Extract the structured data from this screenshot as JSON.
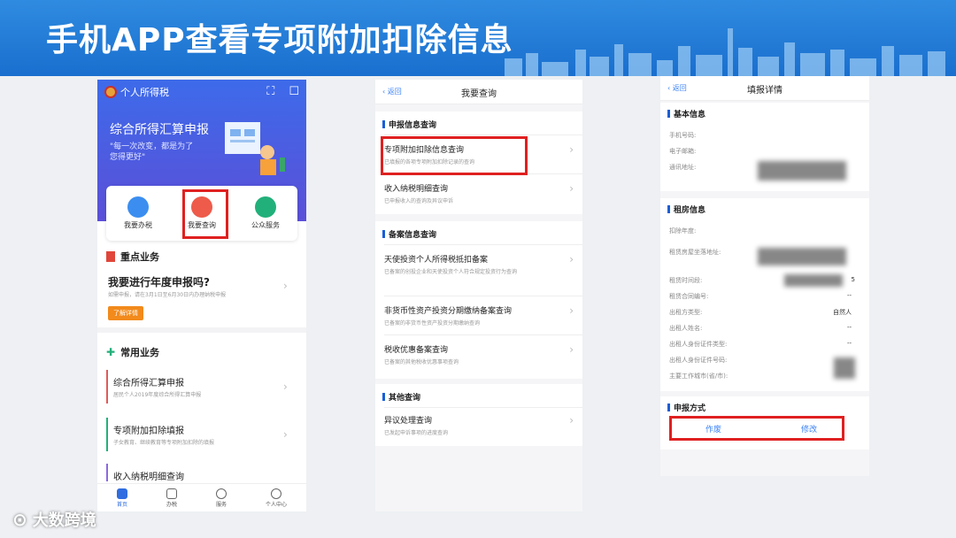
{
  "banner": {
    "title": "手机APP查看专项附加扣除信息"
  },
  "watermark": {
    "text": "大数跨境"
  },
  "phone1": {
    "app_name": "个人所得税",
    "hero_title": "综合所得汇算申报",
    "hero_sub": "\"每一次改变，都是为了您得更好\"",
    "actions": [
      {
        "label": "我要办税"
      },
      {
        "label": "我要查询"
      },
      {
        "label": "公众服务"
      }
    ],
    "section1_title": "重点业务",
    "key_title": "我要进行年度申报吗?",
    "key_sub": "如需申报，请在3月1日至6月30日内办理纳税申报",
    "key_button": "了解详情",
    "section2_title": "常用业务",
    "common": [
      {
        "title": "综合所得汇算申报",
        "sub": "居民个人2019年度综合所得汇算申报"
      },
      {
        "title": "专项附加扣除填报",
        "sub": "子女教育、继续教育等专项附加扣除的填报"
      },
      {
        "title": "收入纳税明细查询",
        "sub": ""
      }
    ],
    "tabs": [
      {
        "label": "首页"
      },
      {
        "label": "办税"
      },
      {
        "label": "服务"
      },
      {
        "label": "个人中心"
      }
    ]
  },
  "phone2": {
    "back": "返回",
    "title": "我要查询",
    "groups": [
      {
        "head": "申报信息查询",
        "items": [
          {
            "title": "专项附加扣除信息查询",
            "sub": "已填报的各项专项附加扣除记录的查询"
          },
          {
            "title": "收入纳税明细查询",
            "sub": "已申报收入的查询及异议申诉"
          }
        ]
      },
      {
        "head": "备案信息查询",
        "items": [
          {
            "title": "天使投资个人所得税抵扣备案",
            "sub": "已备案的创投企业和天使投资个人符合规定投资行为查询"
          },
          {
            "title": "非货币性资产投资分期缴纳备案查询",
            "sub": "已备案的非货币性资产投资分期缴纳查询"
          },
          {
            "title": "税收优惠备案查询",
            "sub": "已备案的其他税收优惠事项查询"
          }
        ]
      },
      {
        "head": "其他查询",
        "items": [
          {
            "title": "异议处理查询",
            "sub": "已发起申诉事项的进度查询"
          }
        ]
      }
    ]
  },
  "phone3": {
    "back": "返回",
    "title": "填报详情",
    "basic_head": "基本信息",
    "basic_fields": [
      "手机号码:",
      "电子邮箱:",
      "通讯地址:"
    ],
    "rent_head": "租房信息",
    "rent_fields": [
      "扣除年度:",
      "租赁房屋坐落地址:",
      "租赁时间段:",
      "租赁合同编号:",
      "出租方类型:",
      "出租人姓名:",
      "出租人身份证件类型:",
      "出租人身份证件号码:",
      "主要工作城市(省/市):"
    ],
    "lessor_type": "自然人",
    "dash": "--",
    "partial": "5",
    "method_head": "申报方式",
    "void_btn": "作废",
    "edit_btn": "修改"
  },
  "colors": {
    "banner": "#1a6fce",
    "highlight": "#e02020",
    "accent": "#3b82f6"
  }
}
